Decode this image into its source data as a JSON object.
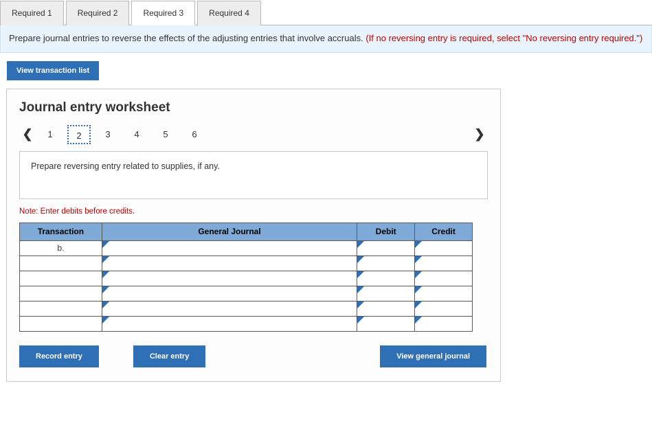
{
  "tabs": {
    "items": [
      "Required 1",
      "Required 2",
      "Required 3",
      "Required 4"
    ],
    "activeIndex": 2
  },
  "instruction": {
    "main": "Prepare journal entries to reverse the effects of the adjusting entries that involve accruals. ",
    "red": "(If no reversing entry is required, select \"No reversing entry required.\")"
  },
  "buttons": {
    "viewTransactionList": "View transaction list",
    "recordEntry": "Record entry",
    "clearEntry": "Clear entry",
    "viewGeneralJournal": "View general journal"
  },
  "worksheet": {
    "heading": "Journal entry worksheet",
    "steps": [
      "1",
      "2",
      "3",
      "4",
      "5",
      "6"
    ],
    "activeStep": "2",
    "prompt": "Prepare reversing entry related to supplies, if any.",
    "note": "Note: Enter debits before credits.",
    "headers": {
      "transaction": "Transaction",
      "general": "General Journal",
      "debit": "Debit",
      "credit": "Credit"
    },
    "rows": [
      {
        "transaction": "b.",
        "general": "",
        "debit": "",
        "credit": ""
      },
      {
        "transaction": "",
        "general": "",
        "debit": "",
        "credit": ""
      },
      {
        "transaction": "",
        "general": "",
        "debit": "",
        "credit": ""
      },
      {
        "transaction": "",
        "general": "",
        "debit": "",
        "credit": ""
      },
      {
        "transaction": "",
        "general": "",
        "debit": "",
        "credit": ""
      },
      {
        "transaction": "",
        "general": "",
        "debit": "",
        "credit": ""
      }
    ]
  }
}
